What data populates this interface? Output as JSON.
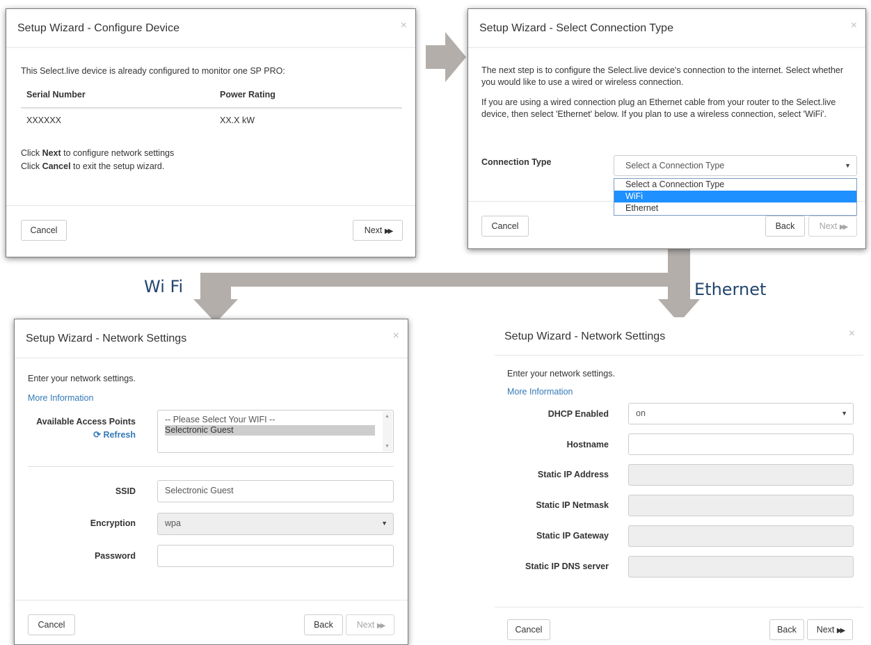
{
  "flow_labels": {
    "wifi": "Wi Fi",
    "ethernet": "Ethernet"
  },
  "configure_device": {
    "title": "Setup Wizard - Configure Device",
    "close": "×",
    "intro": "This Select.live device is already configured to monitor one SP PRO:",
    "columns": [
      "Serial Number",
      "Power Rating"
    ],
    "row": [
      "XXXXXX",
      "XX.X kW"
    ],
    "hint_next_pre": "Click ",
    "hint_next_bold": "Next",
    "hint_next_post": " to configure network settings",
    "hint_cancel_pre": "Click ",
    "hint_cancel_bold": "Cancel",
    "hint_cancel_post": " to exit the setup wizard.",
    "cancel_label": "Cancel",
    "next_label": "Next",
    "next_icon": "fast-forward-icon"
  },
  "connection_type": {
    "title": "Setup Wizard - Select Connection Type",
    "close": "×",
    "para1": "The next step is to configure the Select.live device's connection to the internet. Select whether you would like to use a wired or wireless connection.",
    "para2": "If you are using a wired connection plug an Ethernet cable from your router to the Select.live device, then select 'Ethernet' below. If you plan to use a wireless connection, select 'WiFi'.",
    "field_label": "Connection Type",
    "select_value": "Select a Connection Type",
    "options": [
      "Select a Connection Type",
      "WiFi",
      "Ethernet"
    ],
    "highlighted_option": "WiFi",
    "cancel_label": "Cancel",
    "back_label": "Back",
    "next_label": "Next"
  },
  "wifi_settings": {
    "title": "Setup Wizard - Network Settings",
    "close": "×",
    "intro": "Enter your network settings.",
    "more_info": "More Information",
    "access_points_label": "Available Access Points",
    "refresh_label": "Refresh",
    "access_points": [
      "-- Please Select Your WIFI --",
      "Selectronic Guest"
    ],
    "selected_access_point": "Selectronic Guest",
    "ssid_label": "SSID",
    "ssid_value": "Selectronic Guest",
    "encryption_label": "Encryption",
    "encryption_value": "wpa",
    "password_label": "Password",
    "password_value": "",
    "cancel_label": "Cancel",
    "back_label": "Back",
    "next_label": "Next"
  },
  "ethernet_settings": {
    "title": "Setup Wizard - Network Settings",
    "close": "×",
    "intro": "Enter your network settings.",
    "more_info": "More Information",
    "dhcp_label": "DHCP Enabled",
    "dhcp_value": "on",
    "hostname_label": "Hostname",
    "hostname_value": "",
    "static_ip_label": "Static IP Address",
    "static_netmask_label": "Static IP Netmask",
    "static_gateway_label": "Static IP Gateway",
    "static_dns_label": "Static IP DNS server",
    "cancel_label": "Cancel",
    "back_label": "Back",
    "next_label": "Next"
  },
  "colors": {
    "arrow": "#b3aeaa",
    "flow_label": "#24466e",
    "link": "#337ab7",
    "selected_option": "#1e90ff"
  }
}
